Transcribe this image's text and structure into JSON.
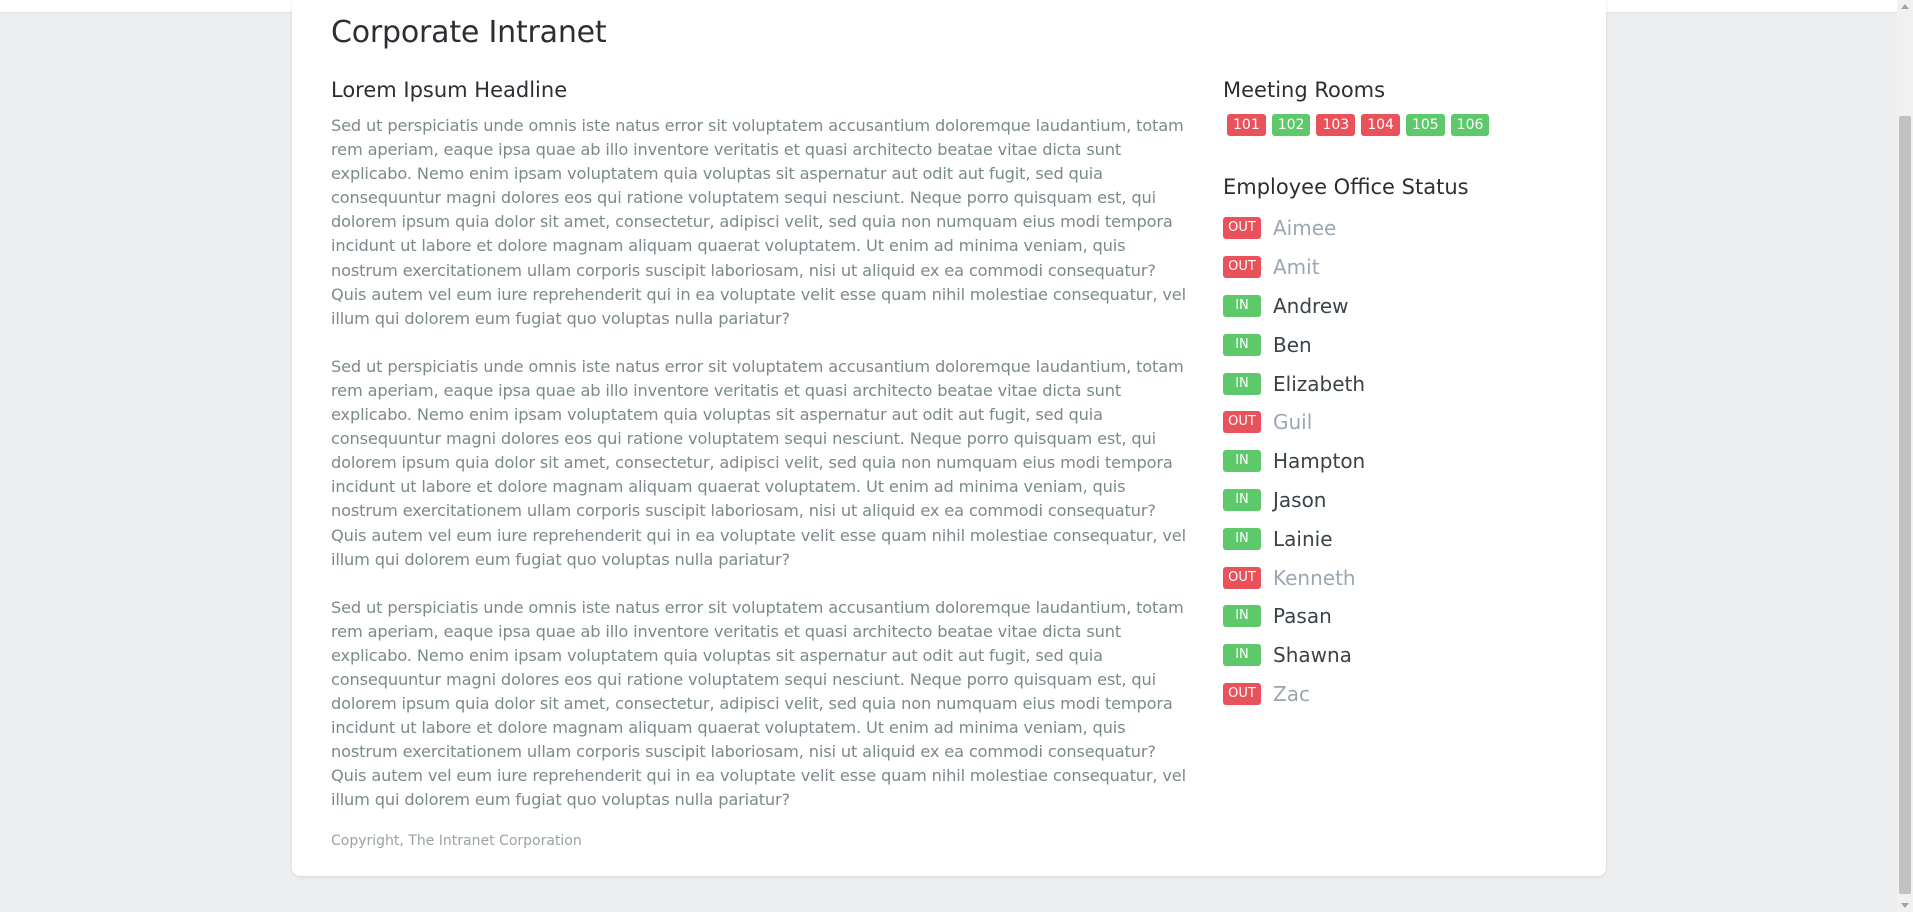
{
  "site": {
    "title": "Corporate Intranet"
  },
  "main": {
    "headline": "Lorem Ipsum Headline",
    "paragraphs": [
      "Sed ut perspiciatis unde omnis iste natus error sit voluptatem accusantium doloremque laudantium, totam rem aperiam, eaque ipsa quae ab illo inventore veritatis et quasi architecto beatae vitae dicta sunt explicabo. Nemo enim ipsam voluptatem quia voluptas sit aspernatur aut odit aut fugit, sed quia consequuntur magni dolores eos qui ratione voluptatem sequi nesciunt. Neque porro quisquam est, qui dolorem ipsum quia dolor sit amet, consectetur, adipisci velit, sed quia non numquam eius modi tempora incidunt ut labore et dolore magnam aliquam quaerat voluptatem. Ut enim ad minima veniam, quis nostrum exercitationem ullam corporis suscipit laboriosam, nisi ut aliquid ex ea commodi consequatur? Quis autem vel eum iure reprehenderit qui in ea voluptate velit esse quam nihil molestiae consequatur, vel illum qui dolorem eum fugiat quo voluptas nulla pariatur?",
      "Sed ut perspiciatis unde omnis iste natus error sit voluptatem accusantium doloremque laudantium, totam rem aperiam, eaque ipsa quae ab illo inventore veritatis et quasi architecto beatae vitae dicta sunt explicabo. Nemo enim ipsam voluptatem quia voluptas sit aspernatur aut odit aut fugit, sed quia consequuntur magni dolores eos qui ratione voluptatem sequi nesciunt. Neque porro quisquam est, qui dolorem ipsum quia dolor sit amet, consectetur, adipisci velit, sed quia non numquam eius modi tempora incidunt ut labore et dolore magnam aliquam quaerat voluptatem. Ut enim ad minima veniam, quis nostrum exercitationem ullam corporis suscipit laboriosam, nisi ut aliquid ex ea commodi consequatur? Quis autem vel eum iure reprehenderit qui in ea voluptate velit esse quam nihil molestiae consequatur, vel illum qui dolorem eum fugiat quo voluptas nulla pariatur?",
      "Sed ut perspiciatis unde omnis iste natus error sit voluptatem accusantium doloremque laudantium, totam rem aperiam, eaque ipsa quae ab illo inventore veritatis et quasi architecto beatae vitae dicta sunt explicabo. Nemo enim ipsam voluptatem quia voluptas sit aspernatur aut odit aut fugit, sed quia consequuntur magni dolores eos qui ratione voluptatem sequi nesciunt. Neque porro quisquam est, qui dolorem ipsum quia dolor sit amet, consectetur, adipisci velit, sed quia non numquam eius modi tempora incidunt ut labore et dolore magnam aliquam quaerat voluptatem. Ut enim ad minima veniam, quis nostrum exercitationem ullam corporis suscipit laboriosam, nisi ut aliquid ex ea commodi consequatur? Quis autem vel eum iure reprehenderit qui in ea voluptate velit esse quam nihil molestiae consequatur, vel illum qui dolorem eum fugiat quo voluptas nulla pariatur?"
    ],
    "copyright": "Copyright, The Intranet Corporation"
  },
  "sidebar": {
    "meeting_rooms_heading": "Meeting Rooms",
    "rooms": [
      {
        "label": "101",
        "status": "busy"
      },
      {
        "label": "102",
        "status": "free"
      },
      {
        "label": "103",
        "status": "busy"
      },
      {
        "label": "104",
        "status": "busy"
      },
      {
        "label": "105",
        "status": "free"
      },
      {
        "label": "106",
        "status": "free"
      }
    ],
    "employee_heading": "Employee Office Status",
    "employees": [
      {
        "status": "OUT",
        "name": "Aimee"
      },
      {
        "status": "OUT",
        "name": "Amit"
      },
      {
        "status": "IN",
        "name": "Andrew"
      },
      {
        "status": "IN",
        "name": "Ben"
      },
      {
        "status": "IN",
        "name": "Elizabeth"
      },
      {
        "status": "OUT",
        "name": "Guil"
      },
      {
        "status": "IN",
        "name": "Hampton"
      },
      {
        "status": "IN",
        "name": "Jason"
      },
      {
        "status": "IN",
        "name": "Lainie"
      },
      {
        "status": "OUT",
        "name": "Kenneth"
      },
      {
        "status": "IN",
        "name": "Pasan"
      },
      {
        "status": "IN",
        "name": "Shawna"
      },
      {
        "status": "OUT",
        "name": "Zac"
      }
    ]
  },
  "colors": {
    "in_badge": "#5ec96b",
    "out_badge": "#e9525b",
    "name_in": "#3a4348",
    "name_out": "#9aa7b3"
  }
}
